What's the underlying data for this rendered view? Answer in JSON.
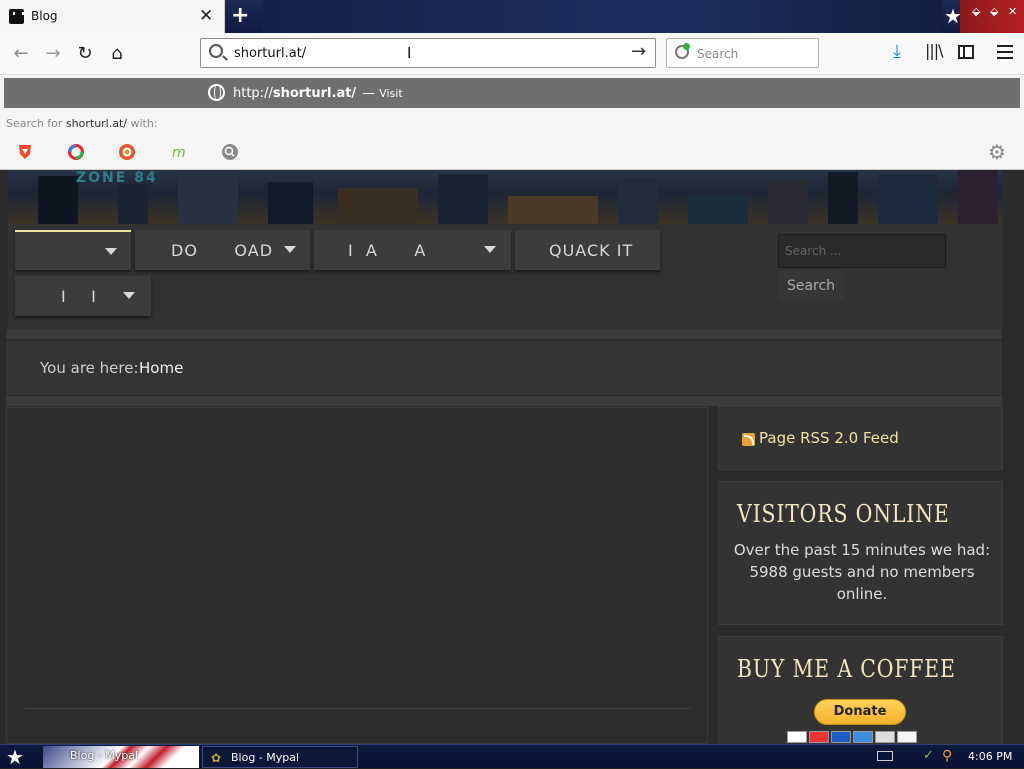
{
  "browser": {
    "tab_title": "Blog",
    "tab_close": "✕",
    "new_tab": "+",
    "url": "shorturl.at/",
    "url_go": "→",
    "search_placeholder": "Search"
  },
  "dropdown": {
    "suggest_prefix": "http://",
    "suggest_url": "shorturl.at/",
    "suggest_dash": "—",
    "suggest_visit": "Visit",
    "searchfor_prefix": "Search for ",
    "searchfor_term": "shorturl.at/",
    "searchfor_suffix": " with:",
    "engines": [
      "brave-icon",
      "qwant-icon",
      "duckduckgo-icon",
      "mojeek-icon",
      "search-engine-icon"
    ]
  },
  "site": {
    "banner_logo": "ZONE 84",
    "menu": [
      {
        "label": ""
      },
      {
        "label": "DO      OAD"
      },
      {
        "label": "I  A      A"
      },
      {
        "label": "QUACK IT"
      },
      {
        "label": "I    I"
      }
    ],
    "search_placeholder": "Search ...",
    "search_button": "Search",
    "breadcrumb_label": "You are here:",
    "breadcrumb_home": "Home",
    "rss_link": "Page RSS 2.0 Feed",
    "visitors_title": "VISITORS ONLINE",
    "visitors_text": "Over the past 15 minutes we had: 5988 guests and no members online.",
    "coffee_title": "BUY ME A COFFEE",
    "donate_label": "Donate",
    "card_icons": [
      "visa-icon",
      "mastercard-icon",
      "maestro-icon",
      "amex-icon",
      "card-icon",
      "discover-icon"
    ]
  },
  "taskbar": {
    "task_1": "Blog - Mypal",
    "task_2": "Blog - Mypal",
    "clock": "4:06 PM"
  },
  "colors": {
    "accent": "#f2e3a2",
    "page_bg": "#2b2b2b",
    "donate": "#f5b12c"
  }
}
